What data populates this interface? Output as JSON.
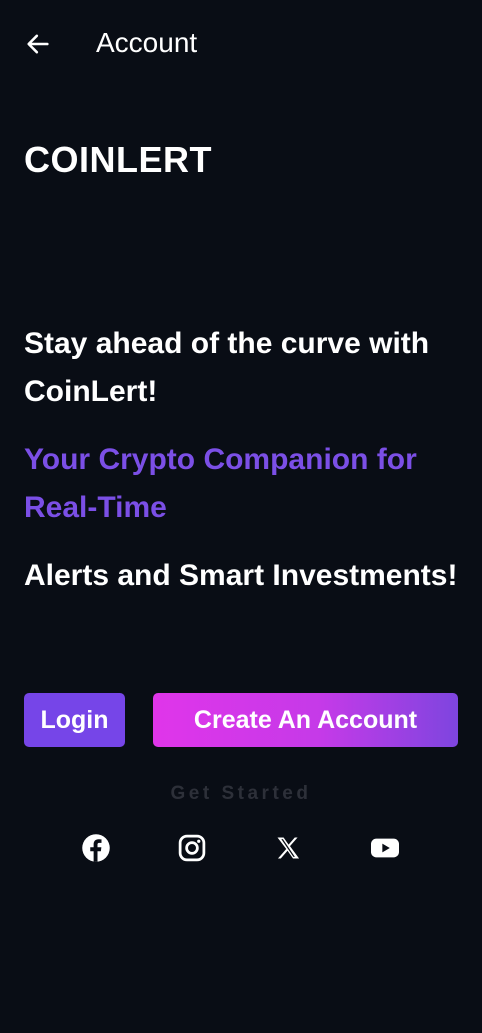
{
  "header": {
    "title": "Account",
    "back_icon": "arrow-left-icon"
  },
  "brand": {
    "name": "COINLERT"
  },
  "hero": {
    "line1": "Stay ahead of the curve with CoinLert!",
    "line2": "Your Crypto Companion for Real-Time",
    "line3": "Alerts and Smart Investments!"
  },
  "actions": {
    "login_label": "Login",
    "create_label": "Create An Account"
  },
  "footer": {
    "get_started": "Get Started",
    "social": [
      "facebook-icon",
      "instagram-icon",
      "x-icon",
      "youtube-icon"
    ]
  },
  "colors": {
    "background": "#090d15",
    "accent_purple": "#7645e8",
    "tagline_purple": "#7b4fe6",
    "gradient_start": "#e035ea",
    "gradient_end": "#7e45df"
  }
}
